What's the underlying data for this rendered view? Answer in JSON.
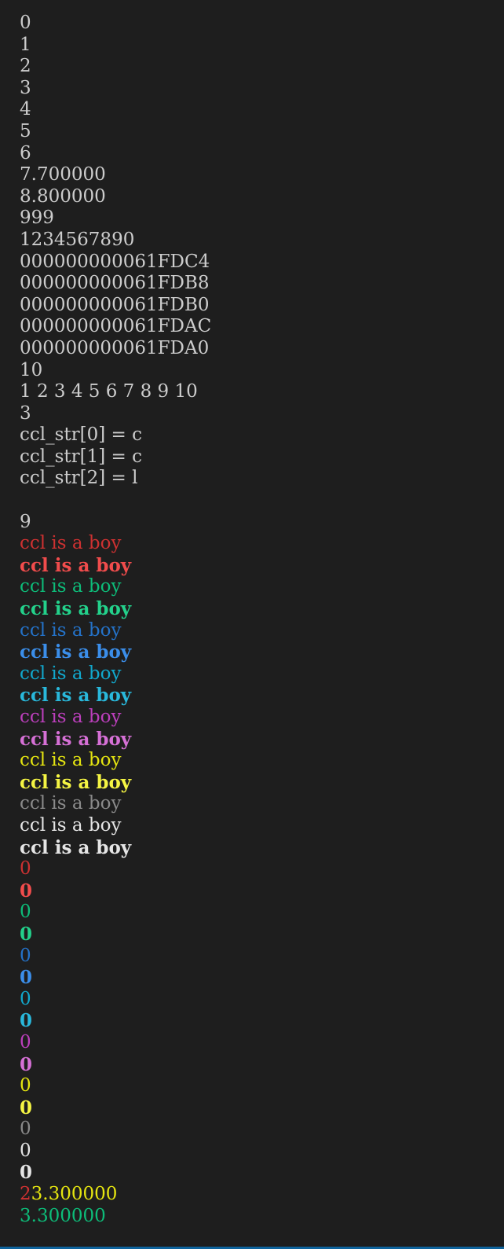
{
  "colors": {
    "background": "#1e1e1e",
    "default": "#cccccc",
    "red": "#cd3131",
    "green": "#0dbc79",
    "blue": "#2472c8",
    "cyan": "#11a8cd",
    "magenta": "#bc3fbc",
    "yellow": "#e5e510",
    "gray": "#8a8a8a",
    "white": "#e5e5e5",
    "status_bar": "#0e639c"
  },
  "output": {
    "plain": [
      "0",
      "1",
      "2",
      "3",
      "4",
      "5",
      "6",
      "7.700000",
      "8.800000",
      "999",
      "1234567890",
      "000000000061FDC4",
      "000000000061FDB8",
      "000000000061FDB0",
      "000000000061FDAC",
      "000000000061FDA0",
      "10",
      "1 2 3 4 5 6 7 8 9 10",
      "3",
      "ccl_str[0] = c",
      "ccl_str[1] = c",
      "ccl_str[2] = l",
      "",
      "9"
    ],
    "colored_text": [
      "ccl is a boy",
      "ccl is a boy",
      "ccl is a boy",
      "ccl is a boy",
      "ccl is a boy",
      "ccl is a boy",
      "ccl is a boy",
      "ccl is a boy",
      "ccl is a boy",
      "ccl is a boy",
      "ccl is a boy",
      "ccl is a boy",
      "ccl is a boy",
      "ccl is a boy",
      "ccl is a boy"
    ],
    "colored_zeros": [
      "0",
      "0",
      "0",
      "0",
      "0",
      "0",
      "0",
      "0",
      "0",
      "0",
      "0",
      "0",
      "0",
      "0",
      "0"
    ],
    "last_lines": {
      "line1_part1": "2",
      "line1_part2": "3.300000",
      "line2": "3.300000"
    }
  }
}
